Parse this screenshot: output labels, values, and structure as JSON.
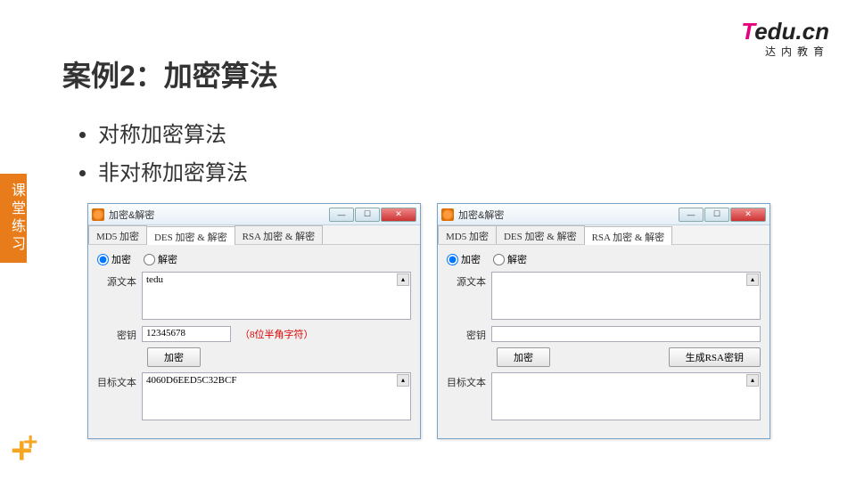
{
  "logo": {
    "t": "T",
    "rest": "edu.cn",
    "sub": "达内教育"
  },
  "page_title": "案例2：加密算法",
  "bullets": [
    "对称加密算法",
    "非对称加密算法"
  ],
  "sidebar": "课堂练习",
  "win1": {
    "title": "加密&解密",
    "tabs": [
      "MD5 加密",
      "DES 加密 & 解密",
      "RSA 加密 & 解密"
    ],
    "active_tab": 1,
    "radio_encrypt": "加密",
    "radio_decrypt": "解密",
    "source_label": "源文本",
    "source_text": "tedu",
    "key_label": "密钥",
    "key_value": "12345678",
    "key_hint": "（8位半角字符）",
    "encrypt_btn": "加密",
    "target_label": "目标文本",
    "target_text": "4060D6EED5C32BCF"
  },
  "win2": {
    "title": "加密&解密",
    "tabs": [
      "MD5 加密",
      "DES 加密 & 解密",
      "RSA 加密 & 解密"
    ],
    "active_tab": 2,
    "radio_encrypt": "加密",
    "radio_decrypt": "解密",
    "source_label": "源文本",
    "source_text": "",
    "key_label": "密钥",
    "key_value": "",
    "encrypt_btn": "加密",
    "gen_key_btn": "生成RSA密钥",
    "target_label": "目标文本",
    "target_text": ""
  }
}
